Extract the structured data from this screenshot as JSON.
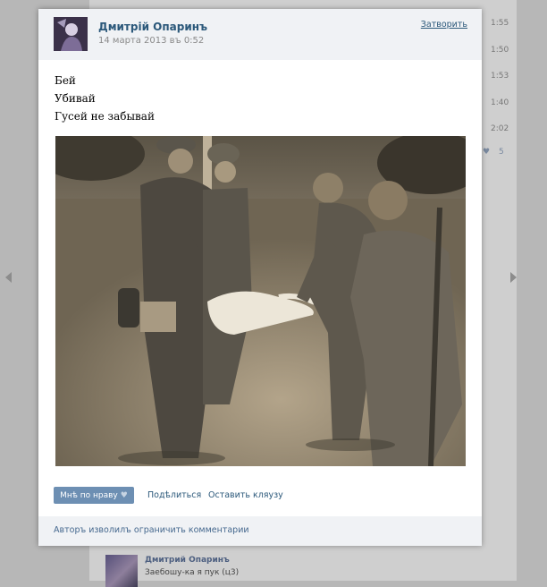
{
  "background": {
    "times": [
      "1:55",
      "1:50",
      "1:53",
      "1:40",
      "2:02"
    ],
    "likes": [
      "5"
    ],
    "comment": {
      "author": "Дмитрий Опаринъ",
      "text": "Заебошу-ка я пук (ц3)"
    }
  },
  "post": {
    "author": "Дмитрій Опаринъ",
    "date": "14 марта 2013 въ 0:52",
    "close_label": "Затворить",
    "text_lines": [
      "Бей",
      "Убивай",
      "Гусей не забывай"
    ],
    "photo_icon": "sepia-photo-soldiers-goose"
  },
  "actions": {
    "like_label": "Мнѣ по нраву",
    "like_icon": "heart-icon",
    "share_label": "Подѣлиться",
    "complain_label": "Оставить кляузу"
  },
  "footer": {
    "text": "Авторъ изволилъ ограничить комментарии"
  },
  "colors": {
    "link": "#2b587a",
    "button": "#6d8fb3",
    "header_bg": "#f0f2f5"
  }
}
